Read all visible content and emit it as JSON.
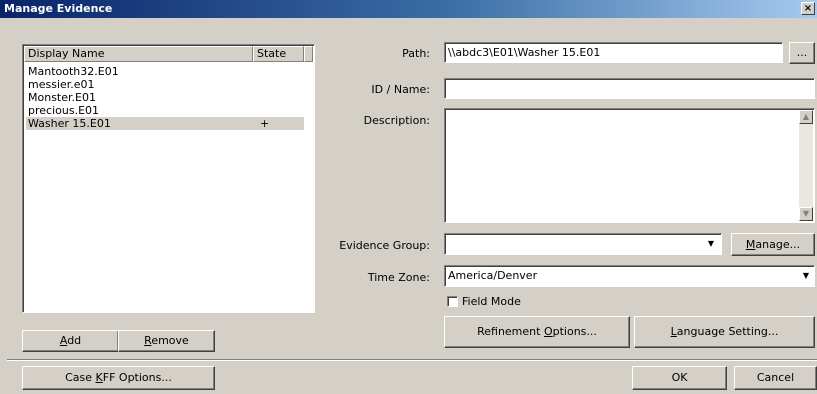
{
  "window": {
    "title": "Manage Evidence",
    "close_glyph": "×"
  },
  "evidence_list": {
    "columns": [
      "Display Name",
      "State"
    ],
    "rows": [
      {
        "name": "Mantooth32.E01",
        "state": ""
      },
      {
        "name": "messier.e01",
        "state": ""
      },
      {
        "name": "Monster.E01",
        "state": ""
      },
      {
        "name": "precious.E01",
        "state": ""
      },
      {
        "name": "Washer 15.E01",
        "state": "+",
        "selected": true
      }
    ]
  },
  "buttons": {
    "add_pre": "",
    "add_key": "A",
    "add_post": "dd",
    "remove_pre": "",
    "remove_key": "R",
    "remove_post": "emove",
    "case_kff_pre": "Case ",
    "case_kff_key": "K",
    "case_kff_post": "FF Options...",
    "browse": "...",
    "manage_pre": "",
    "manage_key": "M",
    "manage_post": "anage...",
    "refinement_pre": "Refinement ",
    "refinement_key": "O",
    "refinement_post": "ptions...",
    "language_pre": "",
    "language_key": "L",
    "language_post": "anguage Setting...",
    "ok": "OK",
    "cancel": "Cancel"
  },
  "form": {
    "path_label": "Path:",
    "path_value": "\\\\abdc3\\E01\\Washer 15.E01",
    "id_label": "ID / Name:",
    "id_value": "",
    "description_label": "Description:",
    "description_value": "",
    "evidence_group_label": "Evidence Group:",
    "evidence_group_value": "",
    "time_zone_label": "Time Zone:",
    "time_zone_value": "America/Denver",
    "field_mode_label": "Field Mode",
    "field_mode_checked": false
  },
  "icons": {
    "dropdown": "▼",
    "scroll_up": "▲",
    "scroll_down": "▼"
  }
}
